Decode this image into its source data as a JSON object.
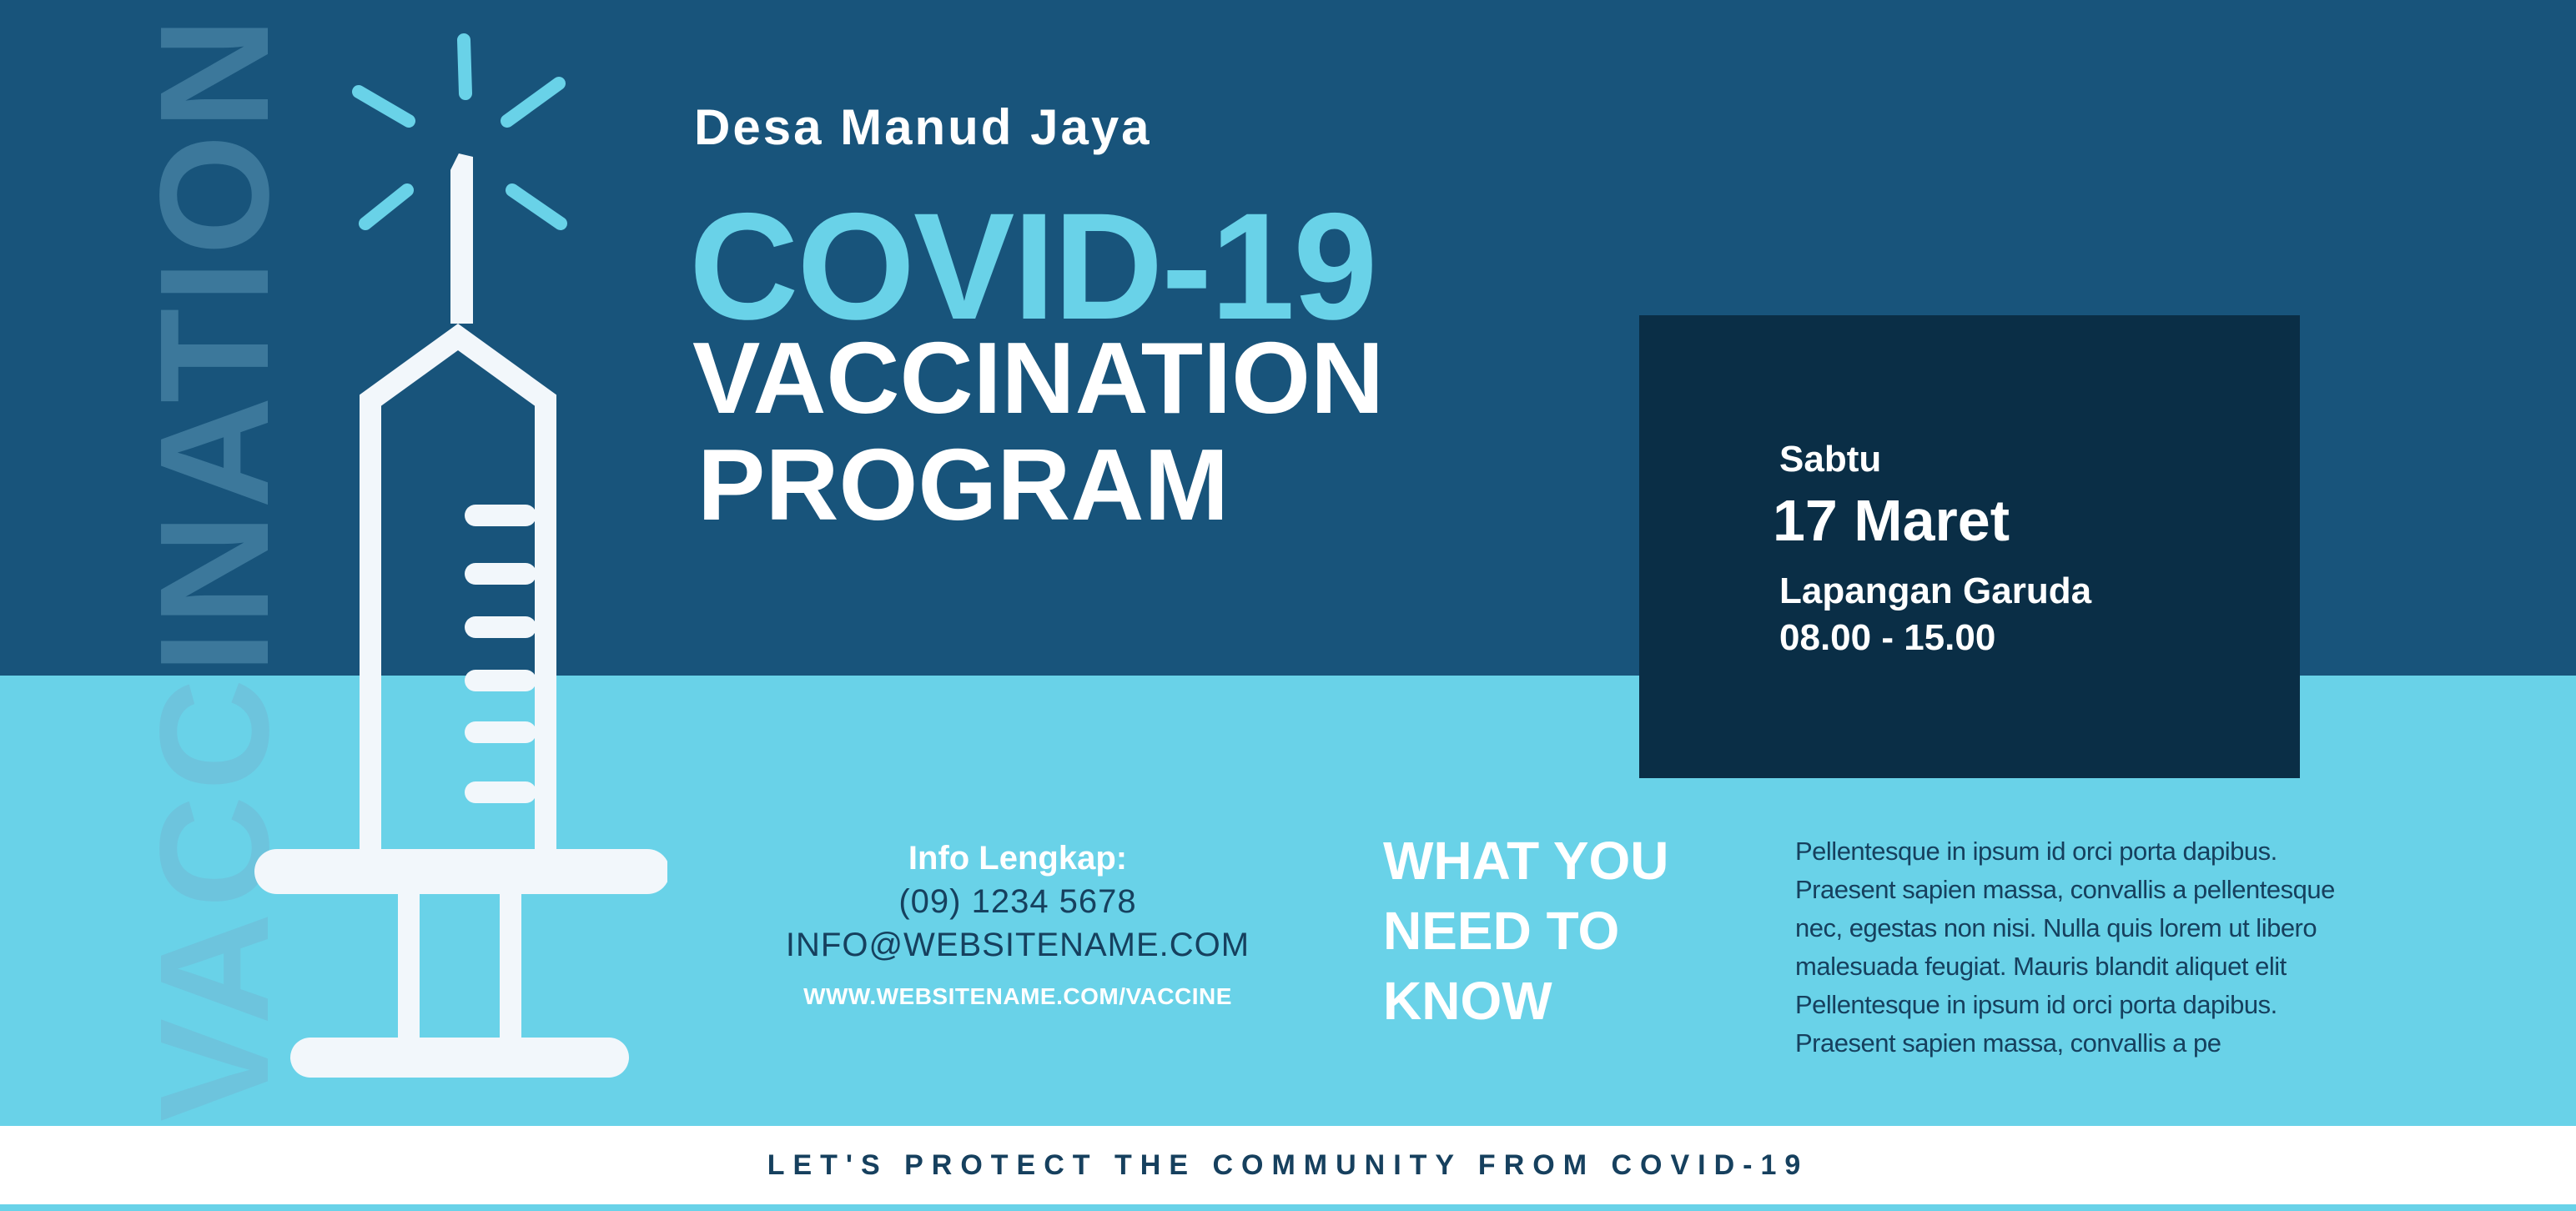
{
  "colors": {
    "dark_blue": "#18547b",
    "light_cyan": "#69d2e8",
    "navy_box": "#0a2e46",
    "text_navy": "#16405e",
    "white": "#ffffff"
  },
  "watermark": "VACCINATION",
  "illustration": {
    "icon": "syringe-icon"
  },
  "header": {
    "organizer": "Desa Manud Jaya",
    "title_line1": "COVID-19",
    "title_line2": "VACCINATION",
    "title_line3": "PROGRAM"
  },
  "event": {
    "day": "Sabtu",
    "date": "17 Maret",
    "venue": "Lapangan Garuda",
    "time": "08.00 - 15.00"
  },
  "info": {
    "heading": "Info Lengkap:",
    "phone": "(09) 1234 5678",
    "email": "INFO@WEBSITENAME.COM",
    "url": "WWW.WEBSITENAME.COM/VACCINE"
  },
  "need_to_know": {
    "heading": "WHAT YOU NEED TO KNOW",
    "body": "Pellentesque in ipsum id orci porta dapibus. Praesent sapien massa, convallis a pellentesque nec, egestas non nisi. Nulla quis lorem ut libero malesuada feugiat. Mauris blandit aliquet elit Pellentesque in ipsum id orci porta dapibus. Praesent sapien massa, convallis a pe"
  },
  "footer": {
    "tagline": "LET'S PROTECT THE COMMUNITY FROM COVID-19"
  }
}
